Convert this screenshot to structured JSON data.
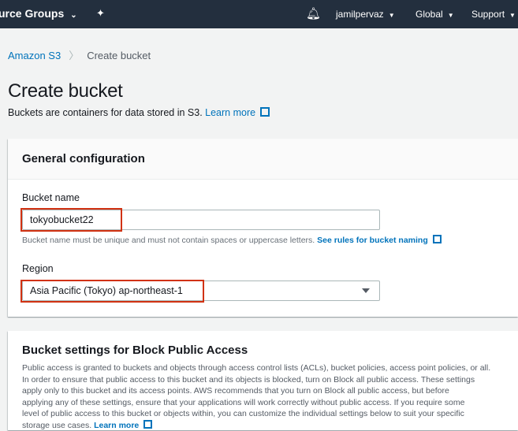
{
  "topbar": {
    "resource_groups": "urce Groups",
    "user": "jamilpervaz",
    "region": "Global",
    "support": "Support"
  },
  "breadcrumb": {
    "root": "Amazon S3",
    "current": "Create bucket"
  },
  "page": {
    "title": "Create bucket",
    "subtitle": "Buckets are containers for data stored in S3.",
    "learn_more": "Learn more"
  },
  "general": {
    "title": "General configuration",
    "bucket_name_label": "Bucket name",
    "bucket_name_value": "tokyobucket22",
    "bucket_name_hint": "Bucket name must be unique and must not contain spaces or uppercase letters.",
    "naming_rules_link": "See rules for bucket naming",
    "region_label": "Region",
    "region_value": "Asia Pacific (Tokyo) ap-northeast-1"
  },
  "block_public": {
    "title": "Bucket settings for Block Public Access",
    "lines": [
      "Public access is granted to buckets and objects through access control lists (ACLs), bucket policies, access point policies, or all.",
      "In order to ensure that public access to this bucket and its objects is blocked, turn on Block all public access. These settings",
      "apply only to this bucket and its access points. AWS recommends that you turn on Block all public access, but before",
      "applying any of these settings, ensure that your applications will work correctly without public access. If you require some",
      "level of public access to this bucket or objects within, you can customize the individual settings below to suit your specific",
      "storage use cases."
    ],
    "learn_more": "Learn more"
  },
  "colors": {
    "topbar": "#232f3e",
    "link": "#0073bb",
    "highlight": "#d13212"
  }
}
